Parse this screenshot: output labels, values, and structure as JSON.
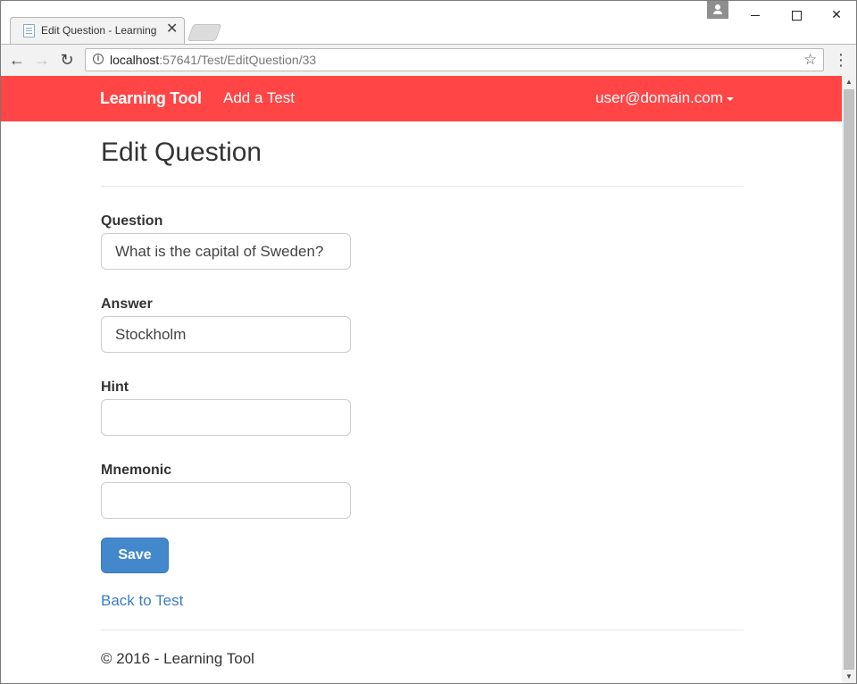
{
  "browser": {
    "tab_title": "Edit Question - Learning",
    "tab_close": "✕",
    "url_host": "localhost",
    "url_path": ":57641/Test/EditQuestion/33"
  },
  "navbar": {
    "brand": "Learning Tool",
    "add_test": "Add a Test",
    "user": "user@domain.com"
  },
  "page": {
    "title": "Edit Question"
  },
  "form": {
    "question_label": "Question",
    "question_value": "What is the capital of Sweden?",
    "answer_label": "Answer",
    "answer_value": "Stockholm",
    "hint_label": "Hint",
    "hint_value": "",
    "mnemonic_label": "Mnemonic",
    "mnemonic_value": "",
    "save_label": "Save"
  },
  "links": {
    "back": "Back to Test"
  },
  "footer": {
    "text": "© 2016 - Learning Tool"
  },
  "colors": {
    "navbar": "#ff4545",
    "primary_button": "#4488cc",
    "link": "#3a7cc4"
  }
}
